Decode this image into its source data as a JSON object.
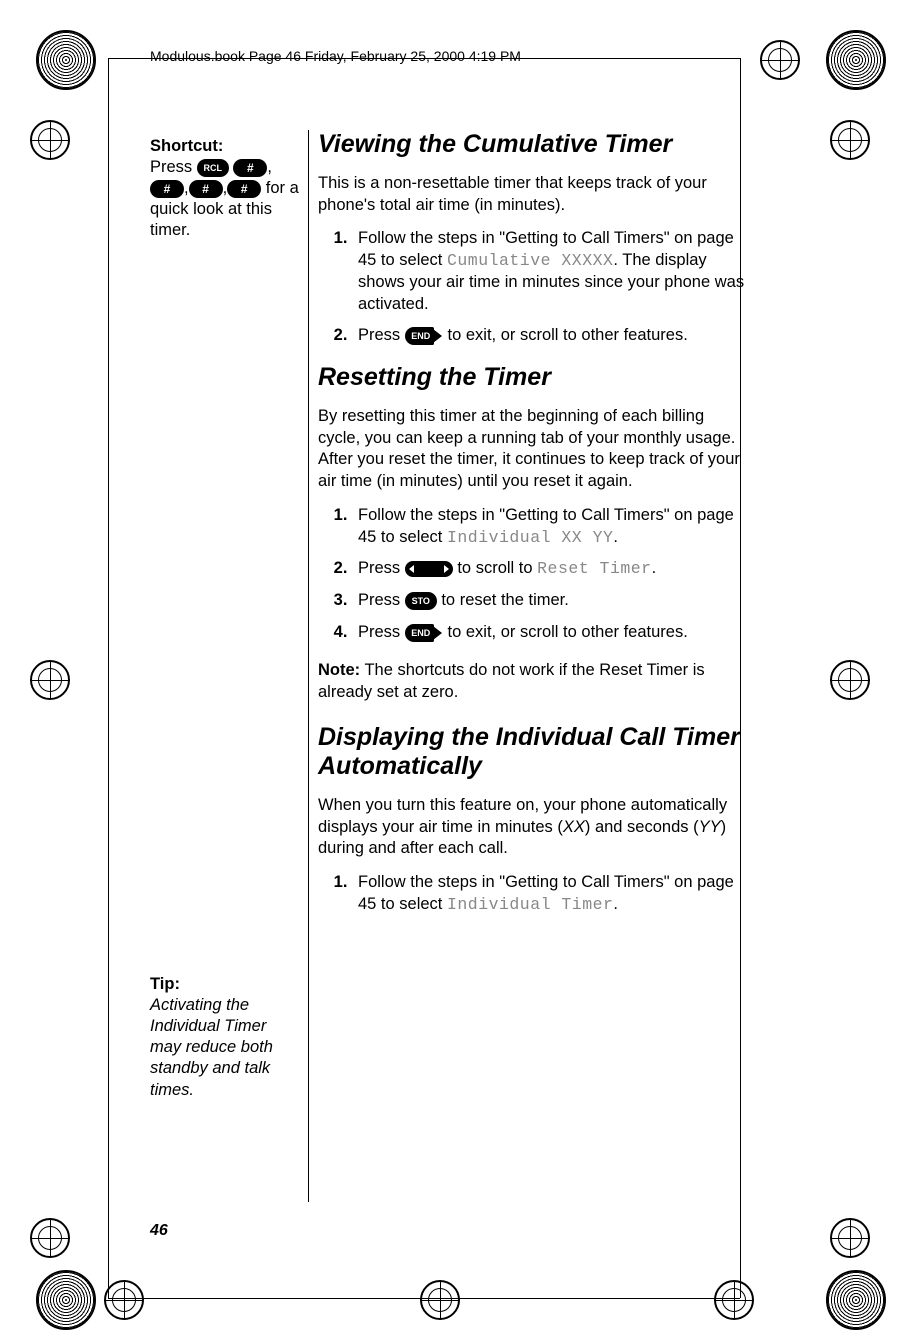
{
  "header": {
    "book_line": "Modulous.book  Page 46  Friday, February 25, 2000  4:19 PM"
  },
  "sidebar": {
    "shortcut": {
      "label": "Shortcut:",
      "press": "Press ",
      "tail": " for a quick look at this timer."
    },
    "tip": {
      "label": "Tip:",
      "body": "Activating the Individual Timer may reduce both standby and talk times."
    }
  },
  "icons": {
    "rcl": "RCL",
    "hash": "#",
    "end": "END",
    "sto": "STO"
  },
  "sections": {
    "s1": {
      "title": "Viewing the Cumulative Timer",
      "intro": "This is a non-resettable timer that keeps track of your phone's total air time (in minutes).",
      "step1a": "Follow the steps in \"Getting to Call Timers\" on page 45 to select ",
      "step1_lcd": "Cumulative XXXXX",
      "step1b": ". The display shows your air time in minutes since your phone was activated.",
      "step2a": "Press ",
      "step2b": " to exit, or scroll to other features."
    },
    "s2": {
      "title": "Resetting the Timer",
      "intro": "By resetting this timer at the beginning of each billing cycle, you can keep a running tab of your monthly usage. After you reset the timer, it continues to keep track of your air time (in minutes) until you reset it again.",
      "step1a": "Follow the steps in \"Getting to Call Timers\" on page 45 to select ",
      "step1_lcd": "Individual XX YY",
      "step1b": ".",
      "step2a": "Press ",
      "step2b": " to scroll to ",
      "step2_lcd": "Reset Timer",
      "step2c": ".",
      "step3a": "Press ",
      "step3b": " to reset the timer.",
      "step4a": "Press ",
      "step4b": " to exit, or scroll to other features.",
      "note_label": "Note:",
      "note_body": " The shortcuts do not work if the Reset Timer is already set at zero."
    },
    "s3": {
      "title": "Displaying the Individual Call Timer Automatically",
      "intro_a": "When you turn this feature on, your phone automatically displays your air time in minutes (",
      "intro_xx": "XX",
      "intro_b": ") and seconds (",
      "intro_yy": "YY",
      "intro_c": ") during and after each call.",
      "step1a": "Follow the steps in \"Getting to Call Timers\" on page 45 to select ",
      "step1_lcd": "Individual Timer",
      "step1b": "."
    }
  },
  "page_number": "46"
}
